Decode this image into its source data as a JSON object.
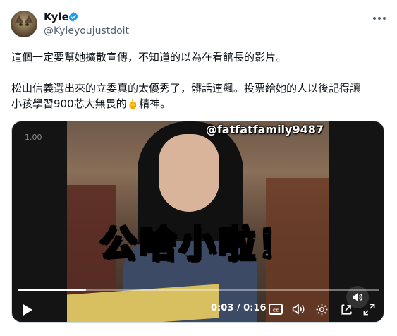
{
  "author": {
    "display_name": "Kyle",
    "handle": "@Kyleyoujustdoit",
    "verified": true
  },
  "tweet": {
    "line_1": "這個一定要幫她擴散宣傳，不知道的以為在看館長的影片。",
    "line_2": "松山信義選出來的立委真的太優秀了，髒話連飆。投票給她的人以後記得讓",
    "line_3_before_emoji": "小孩學習900芯大無畏的",
    "emoji": "🖕",
    "line_3_after_emoji": "精神。"
  },
  "video": {
    "watermark": "@fatfatfamily9487",
    "corner_time": "1.00",
    "caption": "公啥小啦！",
    "current_time": "0:03",
    "separator": "/",
    "duration": "0:16",
    "progress": 0.19,
    "icons": {
      "play": "play-icon",
      "captions": "captions-icon",
      "volume": "volume-icon",
      "settings": "settings-gear-icon",
      "popout": "popout-icon",
      "fullscreen": "fullscreen-icon",
      "more": "more-dots-icon"
    },
    "captions_label": "cc"
  },
  "colors": {
    "verified_blue": "#1d9bf0",
    "handle_gray": "#536471",
    "text": "#0f1419"
  }
}
